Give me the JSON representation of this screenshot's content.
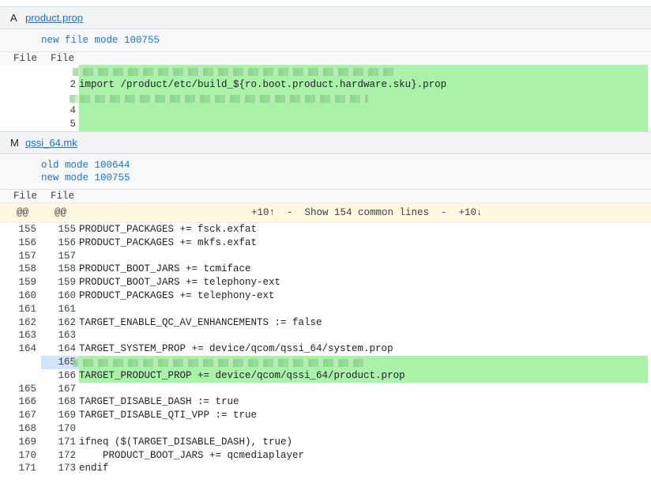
{
  "files": [
    {
      "status": "A",
      "name": "product.prop",
      "modes": [
        "new file mode 100755"
      ],
      "col_headers": [
        "File",
        "File"
      ],
      "lines": [
        {
          "right": "",
          "code": "",
          "added": true,
          "redacted": true
        },
        {
          "right": "2",
          "code": "import /product/etc/build_${ro.boot.product.hardware.sku}.prop",
          "added": true
        },
        {
          "right": "",
          "code": "",
          "added": true,
          "redacted": true
        },
        {
          "right": "4",
          "code": "",
          "added": true
        },
        {
          "right": "5",
          "code": "",
          "added": true
        }
      ]
    },
    {
      "status": "M",
      "name": "qssi_64.mk",
      "modes": [
        "old mode 100644",
        "new mode 100755"
      ],
      "col_headers": [
        "File",
        "File"
      ],
      "skip": {
        "left_at": "@@",
        "right_at": "@@",
        "text": "+10↑  -  Show 154 common lines  -  +10↓"
      },
      "lines": [
        {
          "left": "155",
          "right": "155",
          "code": "PRODUCT_PACKAGES += fsck.exfat"
        },
        {
          "left": "156",
          "right": "156",
          "code": "PRODUCT_PACKAGES += mkfs.exfat"
        },
        {
          "left": "157",
          "right": "157",
          "code": ""
        },
        {
          "left": "158",
          "right": "158",
          "code": "PRODUCT_BOOT_JARS += tcmiface"
        },
        {
          "left": "159",
          "right": "159",
          "code": "PRODUCT_BOOT_JARS += telephony-ext"
        },
        {
          "left": "160",
          "right": "160",
          "code": "PRODUCT_PACKAGES += telephony-ext"
        },
        {
          "left": "161",
          "right": "161",
          "code": ""
        },
        {
          "left": "162",
          "right": "162",
          "code": "TARGET_ENABLE_QC_AV_ENHANCEMENTS := false"
        },
        {
          "left": "163",
          "right": "163",
          "code": ""
        },
        {
          "left": "164",
          "right": "164",
          "code": "TARGET_SYSTEM_PROP += device/qcom/qssi_64/system.prop"
        },
        {
          "left": "",
          "right": "165",
          "code": "",
          "added": true,
          "redacted": true,
          "highlight_gutter": true
        },
        {
          "left": "",
          "right": "166",
          "code": "TARGET_PRODUCT_PROP += device/qcom/qssi_64/product.prop",
          "added": true
        },
        {
          "left": "165",
          "right": "167",
          "code": ""
        },
        {
          "left": "166",
          "right": "168",
          "code": "TARGET_DISABLE_DASH := true"
        },
        {
          "left": "167",
          "right": "169",
          "code": "TARGET_DISABLE_QTI_VPP := true"
        },
        {
          "left": "168",
          "right": "170",
          "code": ""
        },
        {
          "left": "169",
          "right": "171",
          "code": "ifneq ($(TARGET_DISABLE_DASH), true)"
        },
        {
          "left": "170",
          "right": "172",
          "code": "    PRODUCT_BOOT_JARS += qcmediaplayer"
        },
        {
          "left": "171",
          "right": "173",
          "code": "endif"
        }
      ]
    }
  ],
  "colors": {
    "added": "#aaf2aa",
    "link": "#1a73e8",
    "skip_bg": "#fff8e1"
  }
}
